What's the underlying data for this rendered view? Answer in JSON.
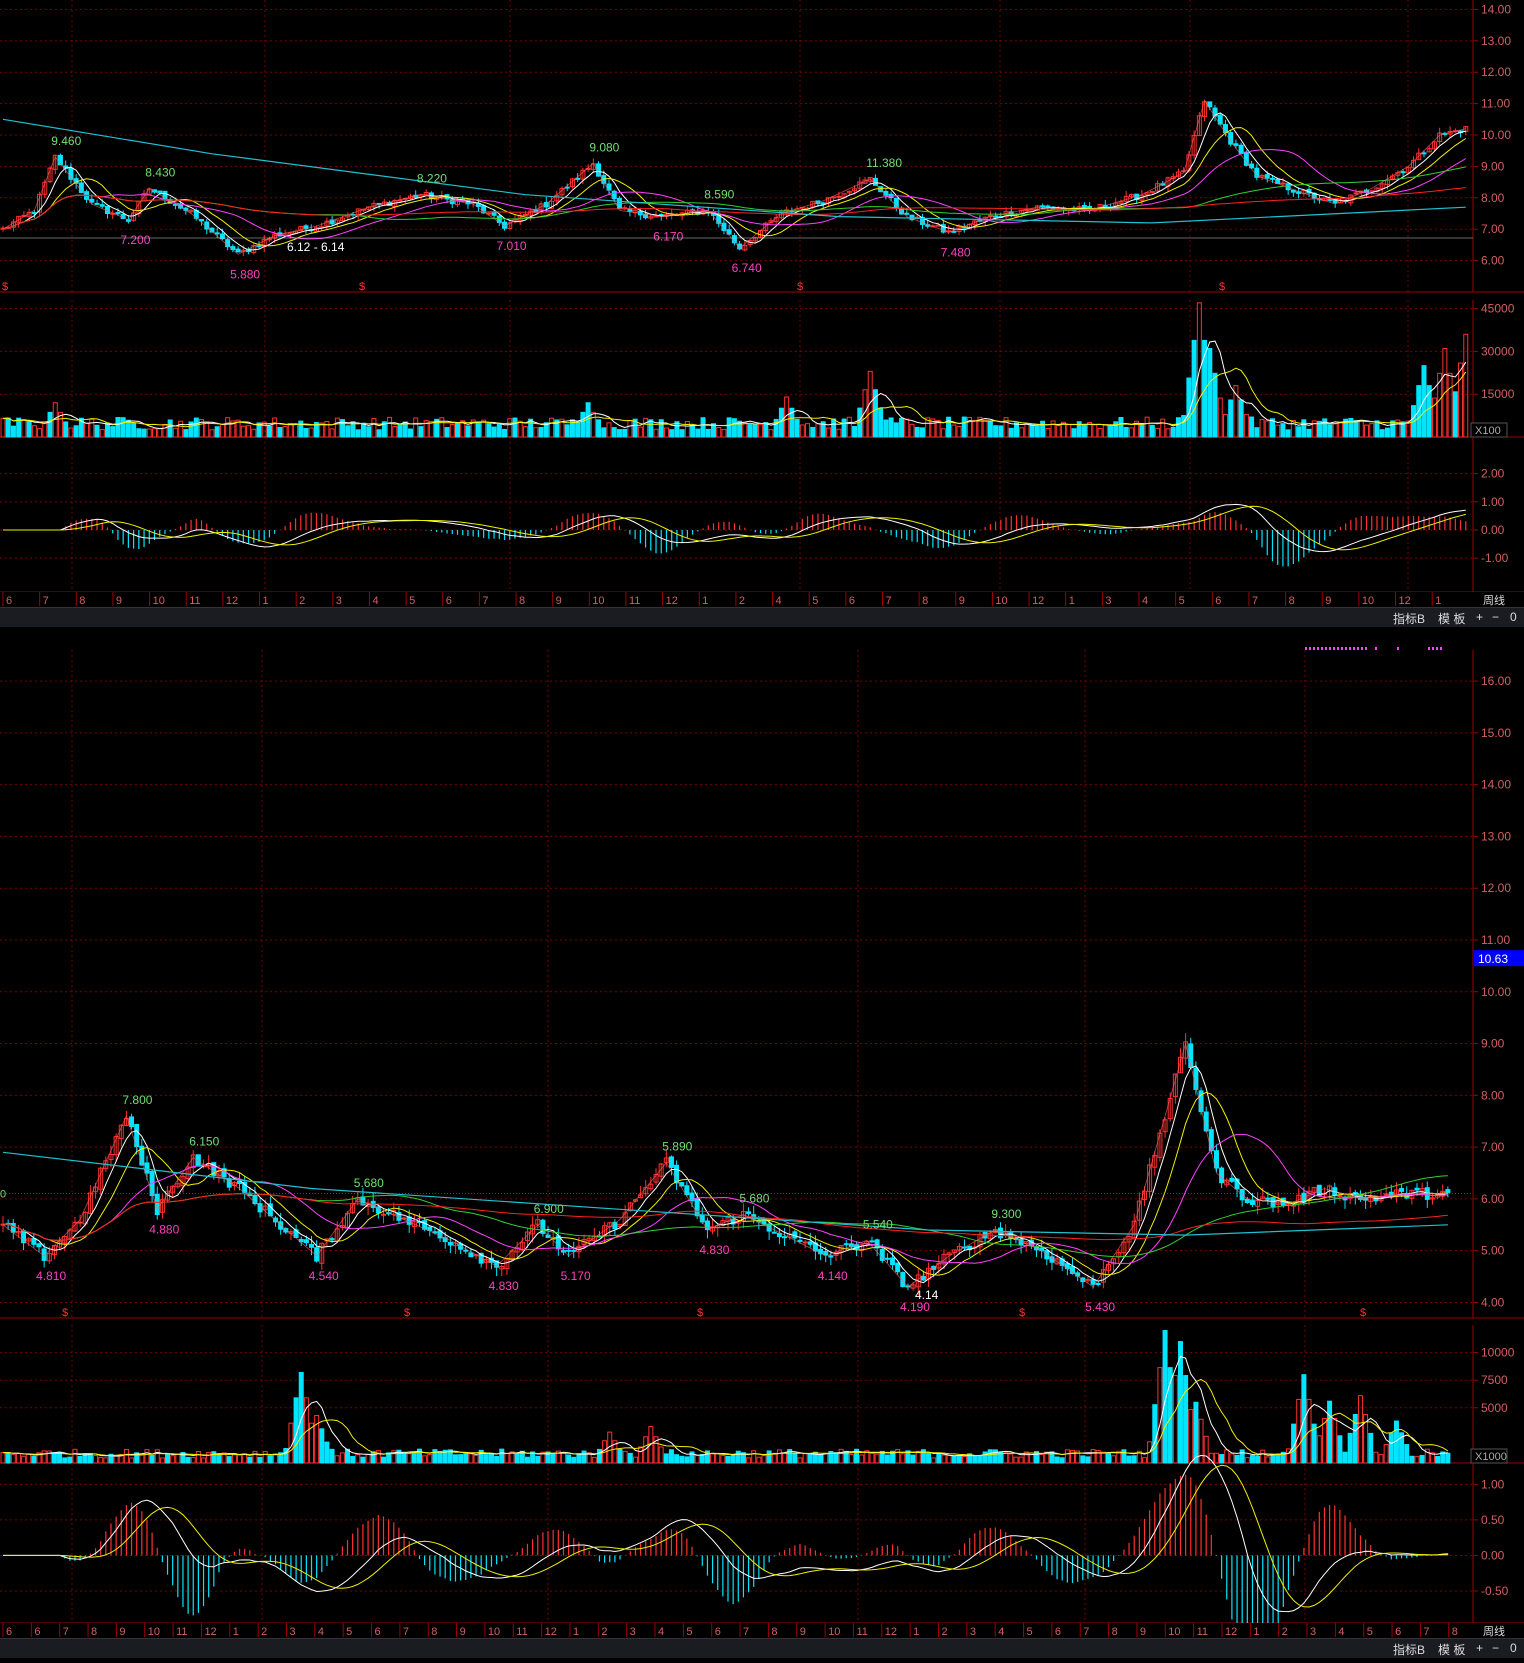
{
  "colors": {
    "bg": "#000000",
    "grid": "#7a0000",
    "axis": "#a00000",
    "tick": "#d06060",
    "up": "#ff3030",
    "down": "#00e5ff",
    "ma5": "#ffffff",
    "ma10": "#f0f000",
    "ma20": "#ff40ff",
    "ma60": "#30d030",
    "ma120": "#ff2020",
    "ma250": "#20c0d0",
    "zig": "#ff6060",
    "hi_label": "#70e070",
    "lo_label": "#ff40c0",
    "price_tag": "#0000ff"
  },
  "toolbar_1": {
    "indicator": "指标B",
    "template": "模 板",
    "plus": "+",
    "minus": "−",
    "zero": "0"
  },
  "toolbar_2": {
    "indicator": "指标B",
    "template": "模 板",
    "plus": "+",
    "minus": "−",
    "zero": "0"
  },
  "chart_data": [
    {
      "type": "candlestick",
      "panel": "top-price",
      "yticks": [
        "14.00",
        "13.00",
        "12.00",
        "11.00",
        "10.00",
        "9.00",
        "8.00",
        "7.00",
        "6.00"
      ],
      "ylim": [
        5.0,
        14.3
      ],
      "period_label": "周线",
      "annotations_high": [
        "9.460",
        "8.430",
        "8.220",
        "9.080",
        "8.590",
        "11.380"
      ],
      "annotations_low": [
        "7.200",
        "5.880",
        "7.010",
        "6.170",
        "6.740",
        "7.480"
      ],
      "range_label": "6.12 - 6.14",
      "x_month_labels": [
        "6",
        "7",
        "8",
        "9",
        "10",
        "11",
        "12",
        "1",
        "2",
        "3",
        "4",
        "5",
        "6",
        "7",
        "8",
        "9",
        "10",
        "11",
        "12",
        "1",
        "2",
        "4",
        "5",
        "6",
        "7",
        "8",
        "9",
        "10",
        "12",
        "1",
        "3",
        "4",
        "5",
        "6",
        "7",
        "8",
        "9",
        "10",
        "12",
        "1",
        "2"
      ],
      "anchors": [
        [
          0,
          7.0
        ],
        [
          6,
          7.6
        ],
        [
          10,
          9.3
        ],
        [
          17,
          7.8
        ],
        [
          24,
          7.3
        ],
        [
          28,
          8.3
        ],
        [
          36,
          7.5
        ],
        [
          45,
          6.2
        ],
        [
          52,
          6.8
        ],
        [
          60,
          7.1
        ],
        [
          70,
          7.7
        ],
        [
          80,
          8.1
        ],
        [
          90,
          7.8
        ],
        [
          96,
          7.1
        ],
        [
          104,
          7.8
        ],
        [
          113,
          9.1
        ],
        [
          118,
          7.6
        ],
        [
          126,
          7.4
        ],
        [
          135,
          7.6
        ],
        [
          141,
          6.4
        ],
        [
          149,
          7.5
        ],
        [
          157,
          7.9
        ],
        [
          166,
          8.6
        ],
        [
          173,
          7.4
        ],
        [
          181,
          6.9
        ],
        [
          189,
          7.4
        ],
        [
          198,
          7.7
        ],
        [
          208,
          7.6
        ],
        [
          218,
          8.1
        ],
        [
          226,
          8.8
        ],
        [
          230,
          11.1
        ],
        [
          235,
          9.8
        ],
        [
          240,
          8.7
        ],
        [
          248,
          8.2
        ],
        [
          255,
          7.8
        ],
        [
          262,
          8.3
        ],
        [
          269,
          9.0
        ],
        [
          275,
          10.0
        ],
        [
          280,
          10.2
        ]
      ],
      "lines": [
        [
          0,
          10.5
        ],
        [
          40,
          9.4
        ],
        [
          100,
          8.1
        ],
        [
          160,
          7.4
        ],
        [
          220,
          7.2
        ],
        [
          280,
          7.7
        ]
      ]
    },
    {
      "type": "bar",
      "panel": "top-volume",
      "yticks": [
        "45000",
        "30000",
        "15000"
      ],
      "ylim": [
        0,
        48000
      ],
      "unit_label": "X100",
      "spikes": [
        [
          10,
          12000
        ],
        [
          112,
          12000
        ],
        [
          150,
          14000
        ],
        [
          166,
          23000
        ],
        [
          229,
          47000
        ],
        [
          231,
          31000
        ],
        [
          236,
          18000
        ],
        [
          272,
          25000
        ],
        [
          276,
          31000
        ],
        [
          280,
          36000
        ]
      ],
      "base": 5000
    },
    {
      "type": "bar",
      "panel": "top-macd",
      "yticks": [
        "2.00",
        "1.00",
        "0.00",
        "-1.00"
      ],
      "ylim": [
        -2.2,
        3.3
      ]
    },
    {
      "type": "candlestick",
      "panel": "bottom-price",
      "yticks": [
        "16.00",
        "15.00",
        "14.00",
        "13.00",
        "12.00",
        "11.00",
        "10.00",
        "9.00",
        "8.00",
        "7.00",
        "6.00",
        "5.00",
        "4.00"
      ],
      "ylim": [
        3.7,
        16.6
      ],
      "price_tag": "10.63",
      "period_label": "周线",
      "annotations_high": [
        "7.800",
        "6.150",
        "5.680",
        "6.900",
        "5.890",
        "5.680",
        "5.540",
        "9.300"
      ],
      "annotations_low": [
        "4.810",
        "4.880",
        "4.540",
        "4.830",
        "5.170",
        "4.830",
        "4.140",
        "4.190",
        "5.430"
      ],
      "range_label": "4.14",
      "left_label": "0",
      "x_month_labels": [
        "6",
        "6",
        "7",
        "8",
        "9",
        "10",
        "11",
        "12",
        "1",
        "2",
        "3",
        "4",
        "5",
        "6",
        "7",
        "8",
        "9",
        "10",
        "11",
        "12",
        "1",
        "2",
        "3",
        "4",
        "5",
        "6",
        "7",
        "8",
        "9",
        "10",
        "11",
        "12",
        "1",
        "2",
        "3",
        "4",
        "5",
        "6",
        "7",
        "8",
        "9",
        "10",
        "11",
        "12",
        "1",
        "2",
        "3",
        "4",
        "5",
        "6",
        "7",
        "8",
        "9"
      ],
      "anchors": [
        [
          0,
          5.5
        ],
        [
          8,
          4.9
        ],
        [
          15,
          5.6
        ],
        [
          24,
          7.6
        ],
        [
          30,
          5.8
        ],
        [
          37,
          6.8
        ],
        [
          46,
          6.2
        ],
        [
          54,
          5.5
        ],
        [
          61,
          4.9
        ],
        [
          69,
          6.0
        ],
        [
          78,
          5.6
        ],
        [
          87,
          5.2
        ],
        [
          96,
          4.7
        ],
        [
          104,
          5.5
        ],
        [
          110,
          4.9
        ],
        [
          120,
          5.6
        ],
        [
          129,
          6.7
        ],
        [
          137,
          5.4
        ],
        [
          144,
          5.7
        ],
        [
          152,
          5.3
        ],
        [
          160,
          4.9
        ],
        [
          168,
          5.2
        ],
        [
          176,
          4.3
        ],
        [
          184,
          4.9
        ],
        [
          193,
          5.4
        ],
        [
          202,
          5.0
        ],
        [
          212,
          4.3
        ],
        [
          220,
          5.5
        ],
        [
          230,
          9.0
        ],
        [
          236,
          6.5
        ],
        [
          242,
          6.0
        ],
        [
          250,
          5.9
        ],
        [
          257,
          6.2
        ],
        [
          264,
          6.0
        ],
        [
          272,
          6.1
        ],
        [
          281,
          6.1
        ]
      ],
      "lines": [
        [
          0,
          6.9
        ],
        [
          60,
          6.2
        ],
        [
          120,
          5.8
        ],
        [
          180,
          5.4
        ],
        [
          230,
          5.3
        ],
        [
          281,
          5.5
        ]
      ]
    },
    {
      "type": "bar",
      "panel": "bottom-volume",
      "yticks": [
        "10000",
        "7500",
        "5000"
      ],
      "ylim": [
        0,
        12500
      ],
      "unit_label": "X1000",
      "spikes": [
        [
          58,
          8200
        ],
        [
          61,
          4300
        ],
        [
          118,
          2800
        ],
        [
          126,
          3300
        ],
        [
          226,
          12000
        ],
        [
          229,
          11000
        ],
        [
          232,
          5500
        ],
        [
          253,
          8000
        ],
        [
          258,
          5600
        ],
        [
          264,
          6100
        ],
        [
          271,
          3800
        ]
      ],
      "base": 900
    },
    {
      "type": "bar",
      "panel": "bottom-macd",
      "yticks": [
        "1.00",
        "0.50",
        "0.00",
        "-0.50"
      ],
      "ylim": [
        -0.95,
        1.3
      ]
    }
  ]
}
